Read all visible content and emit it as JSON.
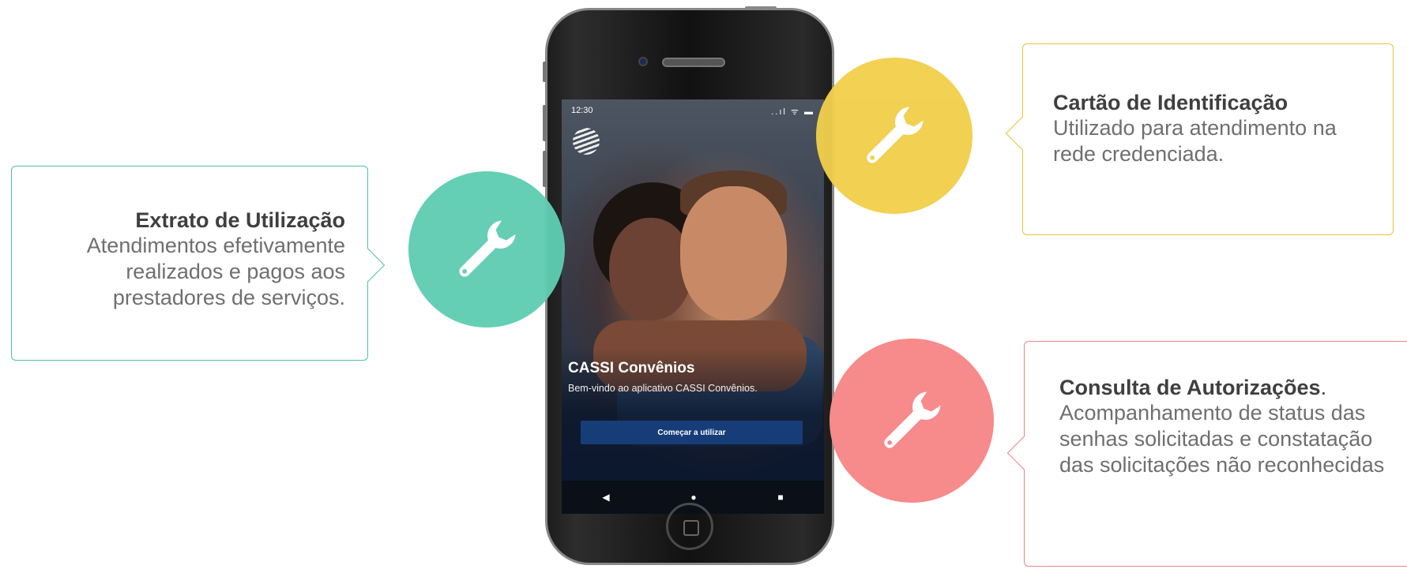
{
  "callouts": {
    "left": {
      "title": "Extrato de Utilização",
      "desc": "Atendimentos efetivamente realizados e pagos aos prestadores de serviços.",
      "color": "#4fc3a6"
    },
    "top_right": {
      "title": "Cartão de Identificação",
      "desc": "Utilizado para atendimento na rede credenciada.",
      "color": "#e9c23a"
    },
    "bottom_right": {
      "title": "Consulta de Autorizações",
      "title_suffix": ".",
      "desc": "Acompanhamento de status das senhas solicitadas e constatação das solicitações não reconhecidas",
      "color": "#f0838a"
    }
  },
  "circles": {
    "green": {
      "icon": "wrench-icon",
      "color": "#5fcdb3"
    },
    "yellow": {
      "icon": "wrench-icon",
      "color": "#f1cf4c"
    },
    "red": {
      "icon": "wrench-icon",
      "color": "#f78a8b"
    }
  },
  "phone": {
    "status_time": "12:30",
    "status_icons": "..ıl ᯤ ▬",
    "app_title": "CASSI Convênios",
    "app_subtitle": "Bem-vindo ao aplicativo CASSI Convênios.",
    "start_button": "Começar a utilizar",
    "nav": {
      "back": "◀",
      "home": "●",
      "recents": "■"
    }
  }
}
